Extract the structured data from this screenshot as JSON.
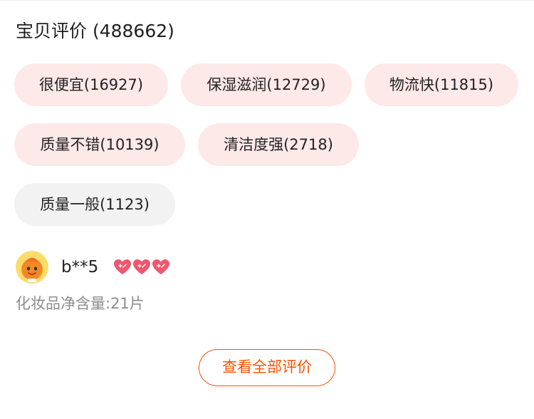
{
  "reviews": {
    "title": "宝贝评价 (488662)",
    "tags": [
      {
        "label": "很便宜(16927)",
        "sentiment": "positive"
      },
      {
        "label": "保湿滋润(12729)",
        "sentiment": "positive"
      },
      {
        "label": "物流快(11815)",
        "sentiment": "positive"
      },
      {
        "label": "质量不错(10139)",
        "sentiment": "positive"
      },
      {
        "label": "清洁度强(2718)",
        "sentiment": "positive"
      },
      {
        "label": "质量一般(1123)",
        "sentiment": "neutral"
      }
    ],
    "review": {
      "username": "b**5",
      "level_icons": [
        "heart-icon",
        "heart-icon",
        "heart-icon"
      ],
      "spec": "化妆品净含量:21片"
    },
    "view_all_label": "查看全部评价"
  },
  "colors": {
    "accent": "#ff5000",
    "positive_tag_bg": "#fde9e8",
    "neutral_tag_bg": "#f2f2f2",
    "muted_text": "#8c8c8c",
    "heart": "#f0566e"
  }
}
